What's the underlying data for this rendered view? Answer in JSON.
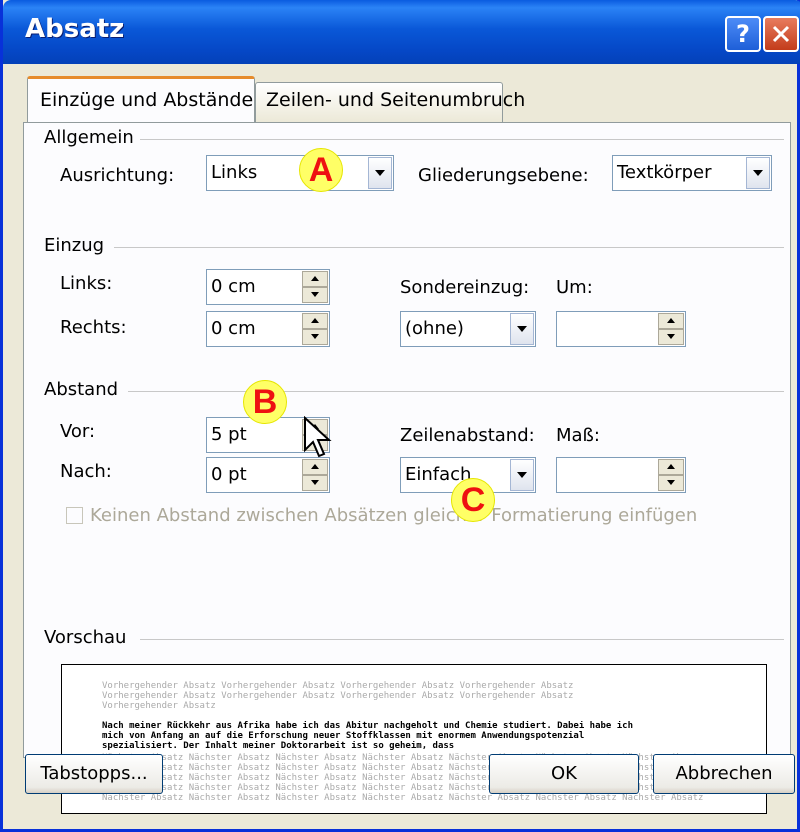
{
  "window": {
    "title": "Absatz",
    "help_icon": "?",
    "close_icon": "close-icon"
  },
  "tabs": [
    {
      "label": "Einzüge und Abstände",
      "active": true
    },
    {
      "label": "Zeilen- und Seitenumbruch",
      "active": false
    }
  ],
  "allgemein": {
    "title": "Allgemein",
    "ausrichtung_label": "Ausrichtung:",
    "ausrichtung_value": "Links",
    "gliederung_label": "Gliederungsebene:",
    "gliederung_value": "Textkörper"
  },
  "einzug": {
    "title": "Einzug",
    "links_label": "Links:",
    "links_value": "0 cm",
    "rechts_label": "Rechts:",
    "rechts_value": "0 cm",
    "sondereinzug_label": "Sondereinzug:",
    "sondereinzug_value": "(ohne)",
    "um_label": "Um:",
    "um_value": ""
  },
  "abstand": {
    "title": "Abstand",
    "vor_label": "Vor:",
    "vor_value": "5 pt",
    "nach_label": "Nach:",
    "nach_value": "0 pt",
    "zeilenabstand_label": "Zeilenabstand:",
    "zeilenabstand_value": "Einfach",
    "mass_label": "Maß:",
    "mass_value": "",
    "checkbox_label": "Keinen Abstand zwischen Absätzen gleicher Formatierung einfügen"
  },
  "markers": {
    "a": "A",
    "b": "B",
    "c": "C"
  },
  "vorschau": {
    "title": "Vorschau",
    "previous_lines": [
      "Vorhergehender Absatz Vorhergehender Absatz Vorhergehender Absatz Vorhergehender Absatz",
      "Vorhergehender Absatz Vorhergehender Absatz Vorhergehender Absatz Vorhergehender Absatz",
      "Vorhergehender Absatz"
    ],
    "main_lines": [
      "Nach meiner Rückkehr aus Afrika habe ich das Abitur nachgeholt und Chemie studiert. Dabei habe ich",
      "mich von Anfang an auf die Erforschung neuer Stoffklassen mit enormem Anwendungspotenzial",
      "spezialisiert. Der Inhalt meiner Doktorarbeit ist so geheim, dass"
    ],
    "next_lines": [
      "Nächster Absatz Nächster Absatz Nächster Absatz Nächster Absatz Nächster Absatz Nächster Absatz Nächster Absatz",
      "Nächster Absatz Nächster Absatz Nächster Absatz Nächster Absatz Nächster Absatz Nächster Absatz Nächster Absatz",
      "Nächster Absatz Nächster Absatz Nächster Absatz Nächster Absatz Nächster Absatz Nächster Absatz Nächster Absatz",
      "Nächster Absatz Nächster Absatz Nächster Absatz Nächster Absatz Nächster Absatz Nächster Absatz Nächster Absatz",
      "Nächster Absatz Nächster Absatz Nächster Absatz Nächster Absatz Nächster Absatz Nächster Absatz Nächster Absatz"
    ]
  },
  "buttons": {
    "tabstopps": "Tabstopps...",
    "ok": "OK",
    "abbrechen": "Abbrechen"
  }
}
